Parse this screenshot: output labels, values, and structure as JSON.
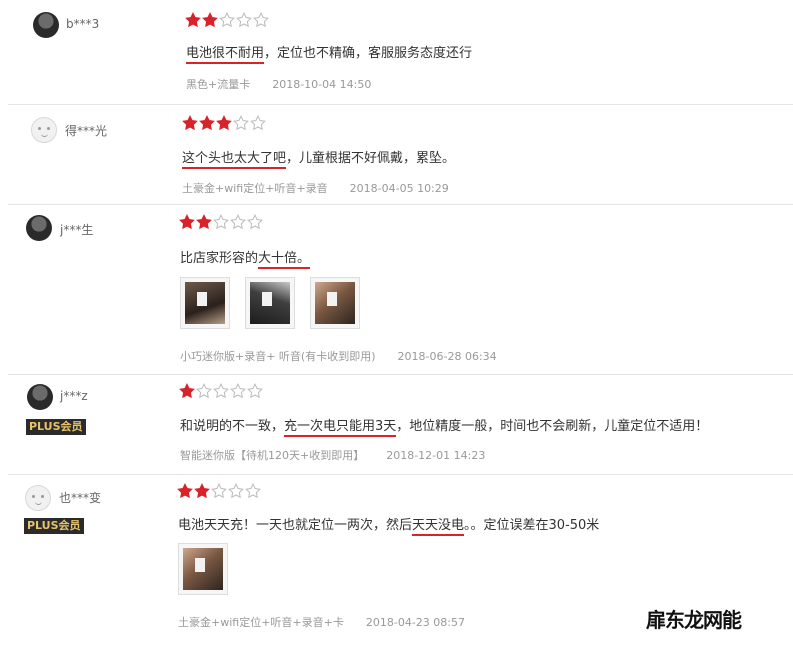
{
  "reviews": [
    {
      "username": "b***3",
      "rating": 2,
      "avatar": "photo",
      "badge": "",
      "text_pre": "",
      "text_u": "电池很不耐用",
      "text_post": "，定位也不精确，客服服务态度还行",
      "variant": "黑色+流量卡",
      "date": "2018-10-04 14:50"
    },
    {
      "username": "得***光",
      "rating": 3,
      "avatar": "default",
      "badge": "",
      "text_pre": "",
      "text_u": "这个头也太大了吧",
      "text_post": "，儿童根据不好佩戴，累坠。",
      "variant": "土豪金+wifi定位+听音+录音",
      "date": "2018-04-05 10:29"
    },
    {
      "username": "j***生",
      "rating": 2,
      "avatar": "photo",
      "badge": "",
      "text_pre": "比店家形容的",
      "text_u": "大十倍。",
      "text_post": "",
      "variant": "小巧迷你版+录音+ 听音(有卡收到即用)",
      "date": "2018-06-28 06:34"
    },
    {
      "username": "j***z",
      "rating": 1,
      "avatar": "photo",
      "badge": "PLUS会员",
      "text_pre": "和说明的不一致，",
      "text_u": "充一次电只能用3天",
      "text_post": "，地位精度一般，时间也不会刷新，儿童定位不适用！",
      "variant": "智能迷你版【待机120天+收到即用】",
      "date": "2018-12-01 14:23"
    },
    {
      "username": "也***变",
      "rating": 2,
      "avatar": "default",
      "badge": "PLUS会员",
      "text_pre": "电池天天充！一天也就定位一两次，然后",
      "text_u": "天天没电",
      "text_post": "。。定位误差在30-50米",
      "variant": "土豪金+wifi定位+听音+录音+卡",
      "date": "2018-04-23 08:57"
    }
  ],
  "watermark": "扉东龙网能",
  "colors": {
    "star": "#d8232a",
    "underline": "#d8232a"
  }
}
